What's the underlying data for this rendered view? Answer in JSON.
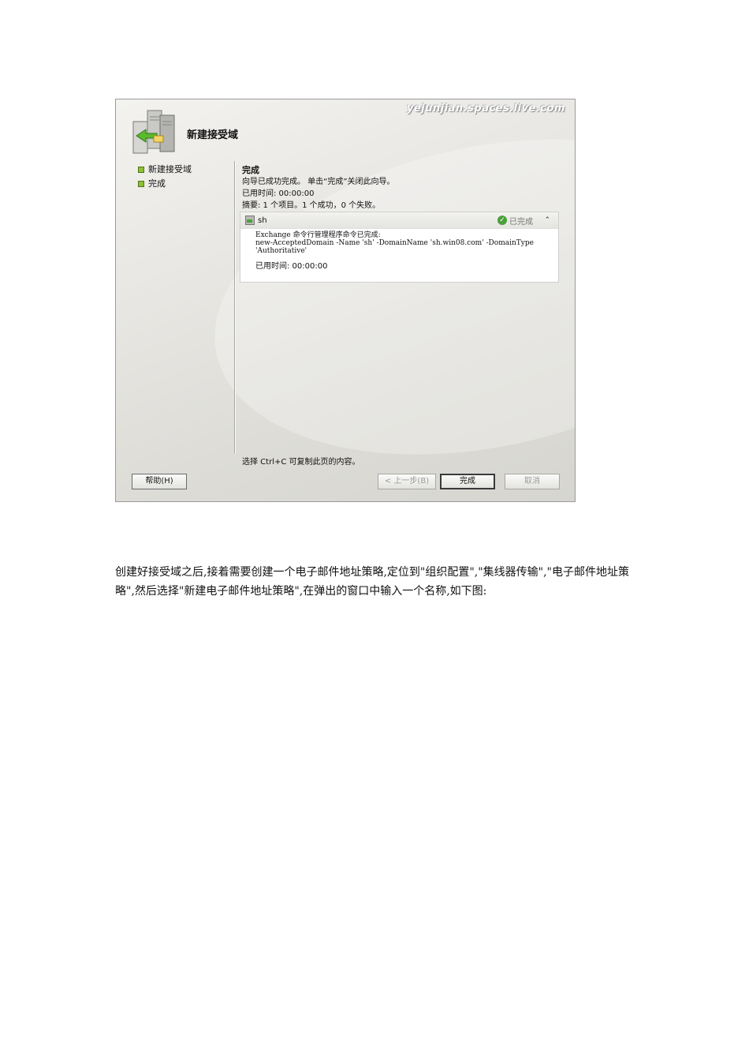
{
  "wizard": {
    "watermark": "yejunjian.spaces.live.com",
    "title": "新建接受域",
    "steps": [
      "新建接受域",
      "完成"
    ],
    "content": {
      "title": "完成",
      "line1": "向导已成功完成。 单击“完成”关闭此向导。",
      "line2": "已用时间: 00:00:00",
      "line3": "摘要: 1 个项目。1 个成功，0 个失败。"
    },
    "task": {
      "name": "sh",
      "status": "已完成",
      "line1": "Exchange 命令行管理程序命令已完成:",
      "line2": "new-AcceptedDomain -Name 'sh' -DomainName 'sh.win08.com' -DomainType",
      "line3": "'Authoritative'",
      "elapsed": "已用时间: 00:00:00"
    },
    "copy_hint": "选择 Ctrl+C 可复制此页的内容。",
    "buttons": {
      "help": "帮助(H)",
      "back": "< 上一步(B)",
      "finish": "完成",
      "cancel": "取消"
    }
  },
  "paragraph": " 创建好接受域之后,接着需要创建一个电子邮件地址策略,定位到\"组织配置\",\"集线器传输\",\"电子邮件地址策略\",然后选择\"新建电子邮件地址策略\",在弹出的窗口中输入一个名称,如下图:"
}
